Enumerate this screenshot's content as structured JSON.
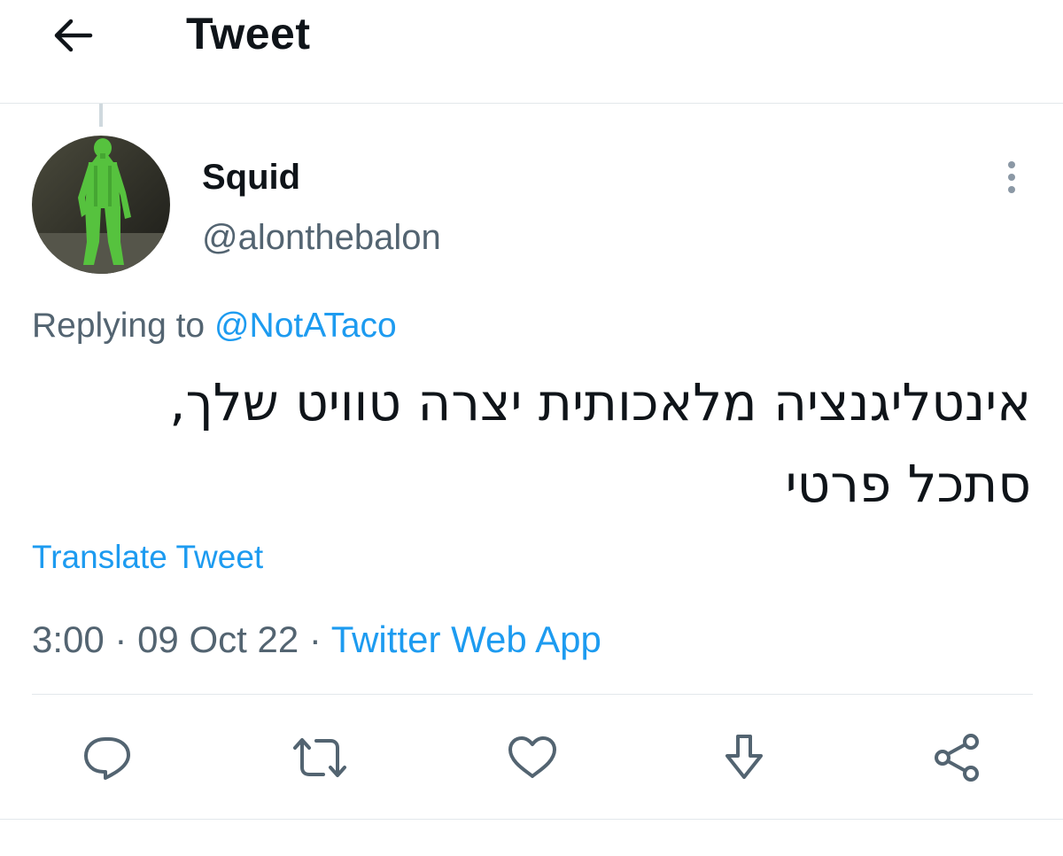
{
  "header": {
    "title": "Tweet",
    "back_icon": "arrow-left-icon"
  },
  "author": {
    "display_name": "Squid",
    "handle": "@alonthebalon",
    "avatar_colors": {
      "figure": "#4fbf3a",
      "background": "#3a3a30"
    }
  },
  "reply_context": {
    "prefix": "Replying to",
    "mention": "@NotATaco"
  },
  "tweet": {
    "lines": [
      "אינטליגנציה מלאכותית יצרה טוויט שלך,",
      "סתכל פרטי"
    ],
    "translate_label": "Translate Tweet"
  },
  "meta": {
    "time": "3:00",
    "date": "09 Oct 22",
    "separator": " · ",
    "source": "Twitter Web App"
  },
  "actions": [
    {
      "name": "reply",
      "icon": "comment-bubble-icon"
    },
    {
      "name": "retweet",
      "icon": "retweet-icon"
    },
    {
      "name": "like",
      "icon": "heart-icon"
    },
    {
      "name": "bookmark",
      "icon": "arrow-down-icon"
    },
    {
      "name": "share",
      "icon": "share-icon"
    }
  ],
  "colors": {
    "accent": "#1d9bf0",
    "secondary_text": "#536471",
    "primary_text": "#0f1419",
    "divider": "#e3e8eb"
  }
}
